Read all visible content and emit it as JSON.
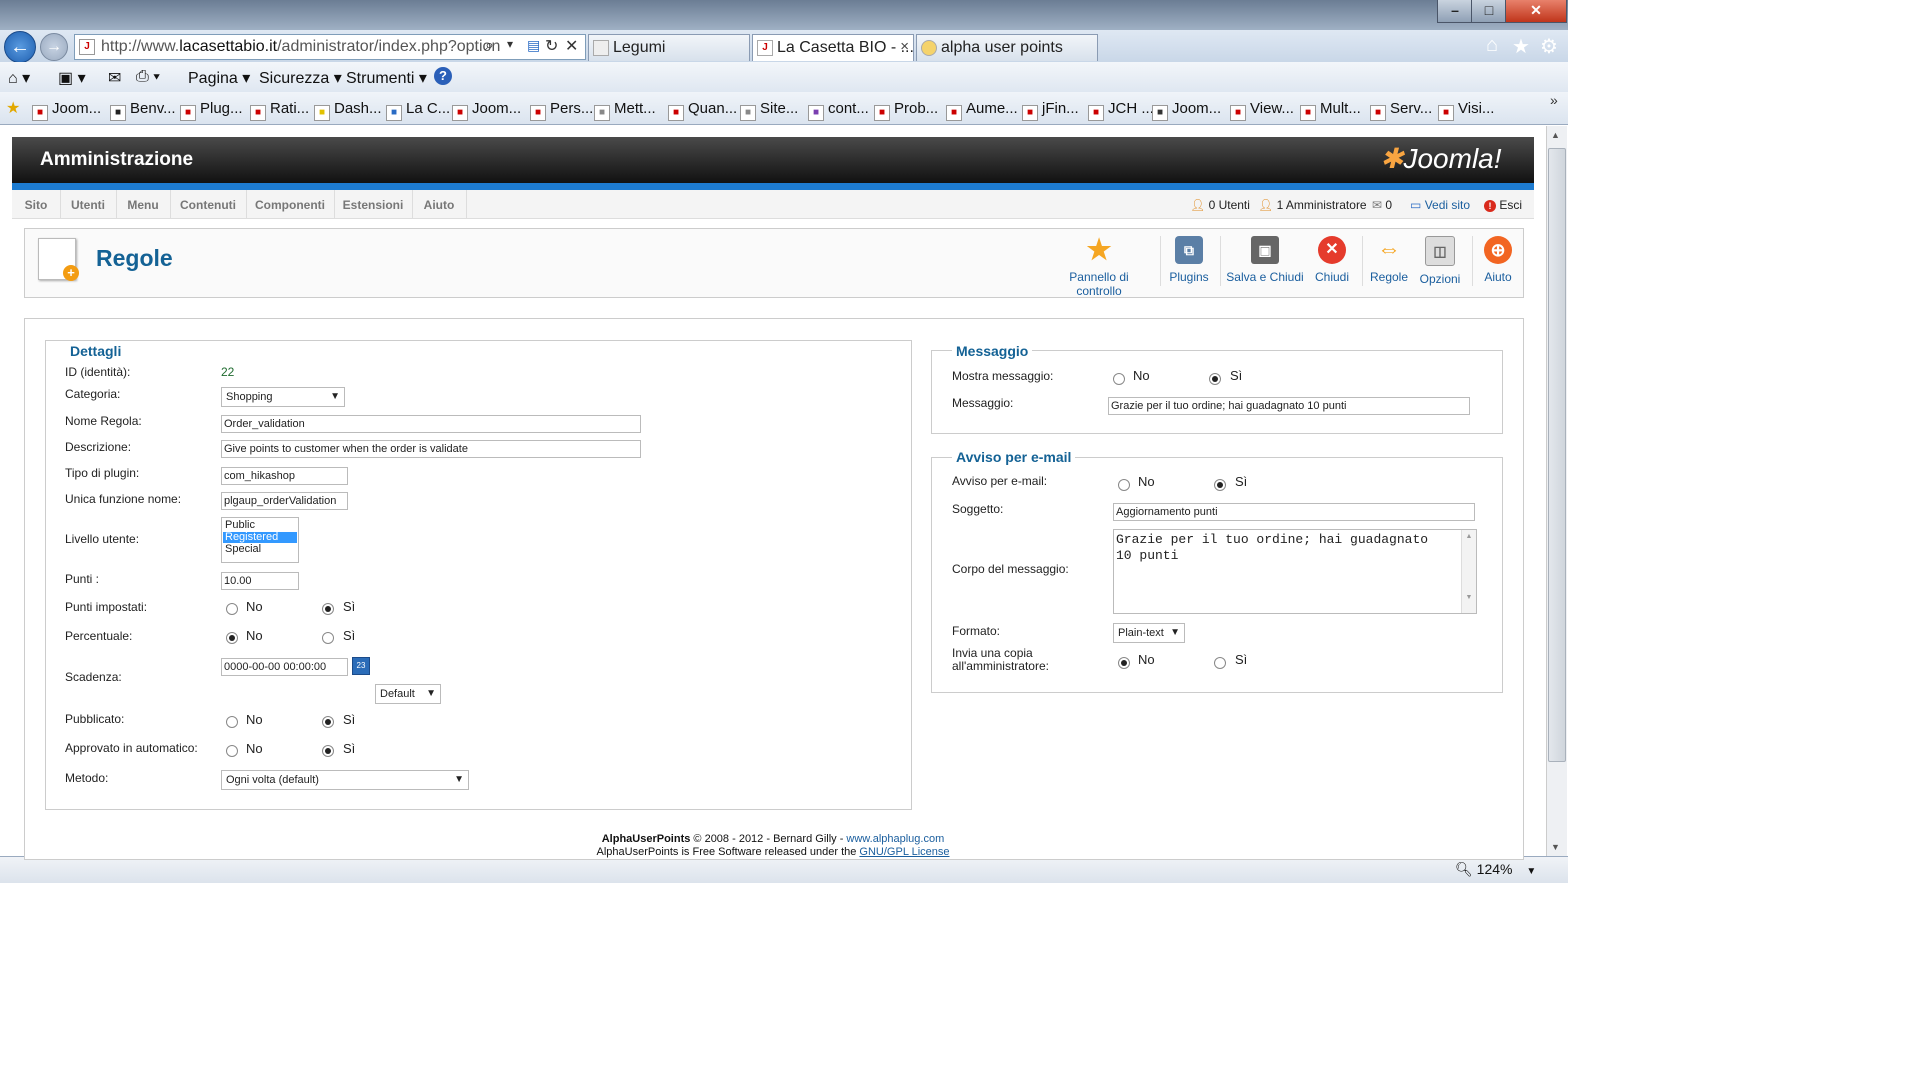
{
  "browser": {
    "address": {
      "prefix": "http://www.",
      "domain": "lacasettabio.it",
      "path": "/administrator/index.php?option"
    },
    "tabs": [
      {
        "label": "Legumi"
      },
      {
        "label": "La Casetta BIO - ..."
      },
      {
        "label": "alpha user points"
      }
    ],
    "command_bar": {
      "page": "Pagina",
      "security": "Sicurezza",
      "tools": "Strumenti"
    },
    "favorites": [
      "Joom...",
      "Benv...",
      "Plug...",
      "Rati...",
      "Dash...",
      "La C...",
      "Joom...",
      "Pers...",
      "Mett...",
      "Quan...",
      "Site...",
      "cont...",
      "Prob...",
      "Aume...",
      "jFin...",
      "JCH ...",
      "Joom...",
      "View...",
      "Mult...",
      "Serv...",
      "Visi..."
    ],
    "zoom": "124%"
  },
  "joomla": {
    "header_title": "Amministrazione",
    "logo_text": "Joomla!",
    "menu": [
      "Sito",
      "Utenti",
      "Menu",
      "Contenuti",
      "Componenti",
      "Estensioni",
      "Aiuto"
    ],
    "status": {
      "users": "0 Utenti",
      "admins": "1 Amministratore",
      "messages": "0",
      "view_site": "Vedi sito",
      "logout": "Esci"
    },
    "page_title": "Regole",
    "toolbar": [
      {
        "label": "Pannello di controllo",
        "icon": "star-icon",
        "color": "#f5a623"
      },
      {
        "label": "Plugins",
        "icon": "plugins-icon",
        "color": "#5b7fa6"
      },
      {
        "label": "Salva e Chiudi",
        "icon": "save-icon",
        "color": "#555555"
      },
      {
        "label": "Chiudi",
        "icon": "close-icon",
        "color": "#e53b2c"
      },
      {
        "label": "Regole",
        "icon": "arrows-icon",
        "color": "#f5a623"
      },
      {
        "label": "Opzioni",
        "icon": "options-icon",
        "color": "#888888"
      },
      {
        "label": "Aiuto",
        "icon": "help-icon",
        "color": "#f26522"
      }
    ]
  },
  "details": {
    "legend": "Dettagli",
    "id_label": "ID (identità):",
    "id_value": "22",
    "category_label": "Categoria:",
    "category_value": "Shopping",
    "rule_name_label": "Nome Regola:",
    "rule_name_value": "Order_validation",
    "description_label": "Descrizione:",
    "description_value": "Give points to customer when the order is validate",
    "plugin_type_label": "Tipo di plugin:",
    "plugin_type_value": "com_hikashop",
    "function_name_label": "Unica funzione nome:",
    "function_name_value": "plgaup_orderValidation",
    "user_level_label": "Livello utente:",
    "user_levels": [
      "Public",
      "Registered",
      "Special"
    ],
    "points_label": "Punti :",
    "points_value": "10.00",
    "fixed_points_label": "Punti impostati:",
    "percentage_label": "Percentuale:",
    "expiry_label": "Scadenza:",
    "expiry_value": "0000-00-00 00:00:00",
    "expiry_select": "Default",
    "published_label": "Pubblicato:",
    "auto_approved_label": "Approvato in automatico:",
    "method_label": "Metodo:",
    "method_value": "Ogni volta (default)",
    "no": "No",
    "yes": "Sì"
  },
  "message": {
    "legend": "Messaggio",
    "show_label": "Mostra messaggio:",
    "message_label": "Messaggio:",
    "message_value": "Grazie per il tuo ordine; hai guadagnato 10 punti",
    "no": "No",
    "yes": "Sì"
  },
  "email": {
    "legend": "Avviso per e-mail",
    "notify_label": "Avviso per e-mail:",
    "subject_label": "Soggetto:",
    "subject_value": "Aggiornamento punti",
    "body_label": "Corpo del messaggio:",
    "body_value": "Grazie per il tuo ordine; hai guadagnato 10 punti",
    "format_label": "Formato:",
    "format_value": "Plain-text",
    "copy_label_1": "Invia una copia",
    "copy_label_2": "all'amministratore:",
    "no": "No",
    "yes": "Sì"
  },
  "footer": {
    "line1_a": "AlphaUserPoints",
    "line1_b": " © 2008 - 2012 - Bernard Gilly - ",
    "line1_link": "www.alphaplug.com",
    "line2_a": "AlphaUserPoints is Free Software released under the ",
    "line2_link": "GNU/GPL License"
  }
}
